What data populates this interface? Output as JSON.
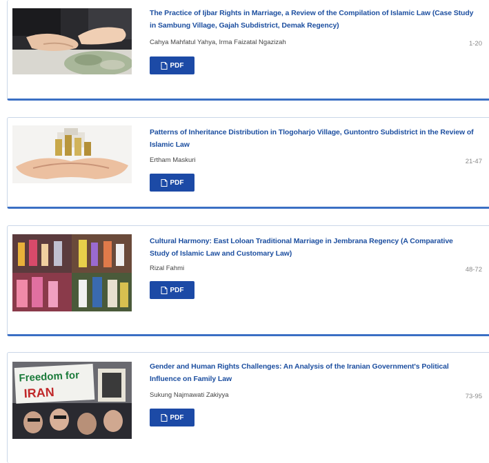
{
  "articles": [
    {
      "title": "The Practice of Ijbar Rights in Marriage, a Review of the Compilation of Islamic Law (Case Study in Sambung Village, Gajah Subdistrict, Demak Regency)",
      "authors": "Cahya Mahfatul Yahya, Irma Faizatal Ngazizah",
      "pages": "1-20",
      "pdf_label": "PDF",
      "thumb_icon": "hands-with-money-photo"
    },
    {
      "title": "Patterns of Inheritance Distribution in Tlogoharjo Village, Guntontro Subdistrict in the Review of Islamic Law",
      "authors": "Ertham Maskuri",
      "pages": "21-47",
      "pdf_label": "PDF",
      "thumb_icon": "hands-holding-coins-photo"
    },
    {
      "title": "Cultural Harmony: East Loloan Traditional Marriage in Jembrana Regency (A Comparative Study of Islamic Law and Customary Law)",
      "authors": "Rizal Fahmi",
      "pages": "48-72",
      "pdf_label": "PDF",
      "thumb_icon": "wedding-ceremony-photo"
    },
    {
      "title": "Gender and Human Rights Challenges: An Analysis of the Iranian Government's Political Influence on Family Law",
      "authors": "Sukung Najmawati Zakiyya",
      "pages": "73-95",
      "pdf_label": "PDF",
      "thumb_icon": "protest-crowd-photo",
      "thumb_text_1": "Freedom for",
      "thumb_text_2": "IRAN"
    }
  ],
  "colors": {
    "title": "#1d4fa0",
    "button": "#1c4aa6",
    "card_border_bottom": "#3a6fc4"
  }
}
